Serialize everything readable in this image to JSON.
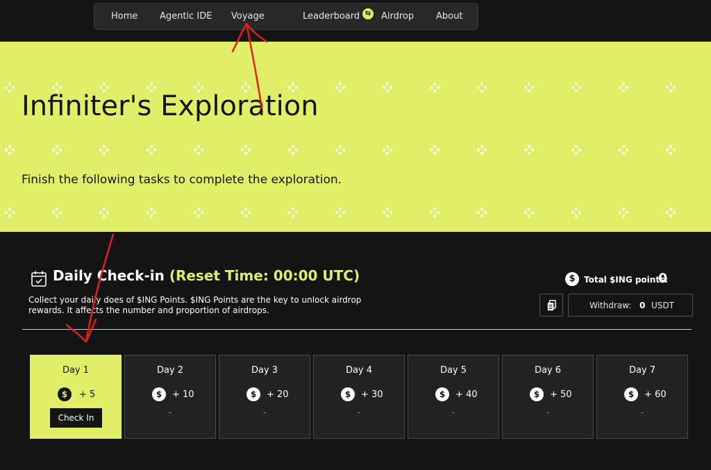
{
  "nav": {
    "items": [
      {
        "label": "Home"
      },
      {
        "label": "Agentic IDE"
      },
      {
        "label": "Voyage"
      },
      {
        "label": "Leaderboard"
      },
      {
        "label": "Airdrop"
      },
      {
        "label": "About"
      }
    ],
    "voyage_badge_icon": "exchange-icon"
  },
  "hero": {
    "title": "Infiniter's Exploration",
    "subtitle": "Finish the following tasks to complete the exploration."
  },
  "checkin": {
    "title": "Daily Check-in",
    "reset": "(Reset Time: 00:00 UTC)",
    "description": "Collect your daily does of $ING Points. $ING Points are the key to unlock airdrop rewards. It affects the number and proportion of airdrops.",
    "total_label": "Total $ING points:",
    "total_value": "0",
    "withdraw_label": "Withdraw:",
    "withdraw_amount": "0",
    "withdraw_currency": "USDT",
    "check_in_label": "Check In",
    "days": [
      {
        "label": "Day 1",
        "reward": "+ 5",
        "status": "",
        "active": true
      },
      {
        "label": "Day 2",
        "reward": "+ 10",
        "status": "-",
        "active": false
      },
      {
        "label": "Day 3",
        "reward": "+ 20",
        "status": "-",
        "active": false
      },
      {
        "label": "Day 4",
        "reward": "+ 30",
        "status": "-",
        "active": false
      },
      {
        "label": "Day 5",
        "reward": "+ 40",
        "status": "-",
        "active": false
      },
      {
        "label": "Day 6",
        "reward": "+ 50",
        "status": "-",
        "active": false
      },
      {
        "label": "Day 7",
        "reward": "+ 60",
        "status": "-",
        "active": false
      }
    ]
  },
  "colors": {
    "accent": "#e1ee67",
    "background": "#141414",
    "card": "#222222",
    "annotation": "#e0201e"
  }
}
